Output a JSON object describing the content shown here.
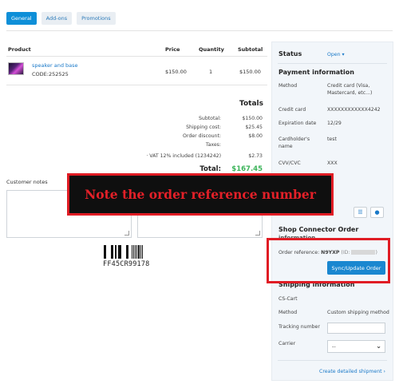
{
  "tabs": [
    {
      "label": "General",
      "active": true
    },
    {
      "label": "Add-ons",
      "active": false
    },
    {
      "label": "Promotions",
      "active": false
    }
  ],
  "products_table": {
    "headers": {
      "product": "Product",
      "price": "Price",
      "quantity": "Quantity",
      "subtotal": "Subtotal"
    },
    "rows": [
      {
        "name": "speaker and base",
        "code": "CODE:252525",
        "price": "$150.00",
        "quantity": "1",
        "subtotal": "$150.00"
      }
    ]
  },
  "totals": {
    "title": "Totals",
    "lines": [
      {
        "label": "Subtotal:",
        "value": "$150.00"
      },
      {
        "label": "Shipping cost:",
        "value": "$25.45"
      },
      {
        "label": "Order discount:",
        "value": "$8.00"
      },
      {
        "label": "Taxes:",
        "value": ""
      },
      {
        "label": "· VAT 12% included (1234242)",
        "value": "$2.73"
      }
    ],
    "total_label": "Total:",
    "total_value": "$167.45"
  },
  "notes": {
    "label": "Customer notes"
  },
  "barcode": {
    "text": "FF45CR99178"
  },
  "sidebar": {
    "status_label": "Status",
    "status_value": "Open",
    "payment_title": "Payment information",
    "payment_rows": [
      {
        "label": "Method",
        "value": "Credit card (Visa, Mastercard, etc...)"
      },
      {
        "label": "Credit card",
        "value": "XXXXXXXXXXXX4242"
      },
      {
        "label": "Expiration date",
        "value": "12/29"
      },
      {
        "label": "Cardholder's name",
        "value": "test"
      },
      {
        "label": "CVV/CVC",
        "value": "XXX"
      }
    ],
    "shop_connector_title": "Shop Connector Order",
    "shop_connector_title_2": "information",
    "order_reference_label": "Order reference:",
    "order_reference_value": "N9YXP",
    "order_reference_id_label": "(ID:",
    "order_reference_id_close": ")",
    "sync_button": "Sync/Update Order",
    "shipping_title": "Shipping information",
    "shipping_carrier_name": "CS-Cart",
    "shipping_rows": [
      {
        "label": "Method",
        "value": "Custom shipping method"
      },
      {
        "label": "Tracking number",
        "value": ""
      },
      {
        "label": "Carrier",
        "value": "--"
      }
    ],
    "create_shipment_link": "Create detailed shipment ›"
  },
  "overlay": {
    "banner_text": "Note the order reference number"
  },
  "colors": {
    "accent": "#0e8fd8",
    "total_green": "#3cb45a",
    "overlay_red": "#e01c24"
  }
}
